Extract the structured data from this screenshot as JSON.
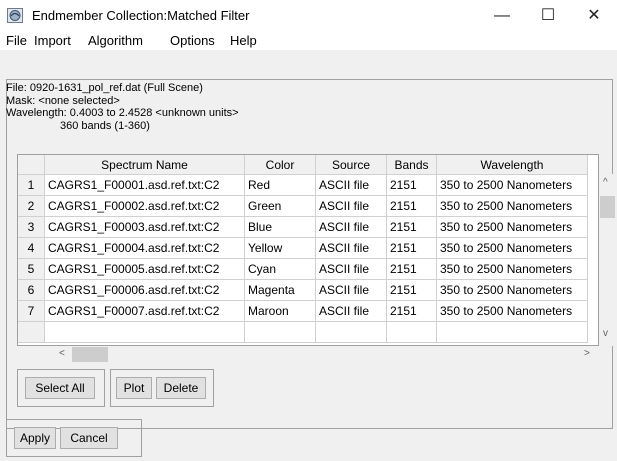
{
  "window": {
    "title": "Endmember Collection:Matched Filter",
    "minimize": "—",
    "maximize": "☐",
    "close": "✕",
    "icon": "envi-app-icon"
  },
  "menubar": [
    "File",
    "Import",
    "Algorithm",
    "Options",
    "Help"
  ],
  "info": {
    "file": "File: 0920-1631_pol_ref.dat (Full Scene)",
    "mask": "Mask: <none selected>",
    "wavelength": "Wavelength: 0.4003 to 2.4528 <unknown units>",
    "bands": "360 bands (1-360)"
  },
  "table": {
    "columns": [
      "Spectrum Name",
      "Color",
      "Source",
      "Bands",
      "Wavelength"
    ],
    "rows": [
      {
        "num": "1",
        "name": "CAGRS1_F00001.asd.ref.txt:C2",
        "color": "Red",
        "source": "ASCII file",
        "bands": "2151",
        "wavelength": "350 to 2500 Nanometers"
      },
      {
        "num": "2",
        "name": "CAGRS1_F00002.asd.ref.txt:C2",
        "color": "Green",
        "source": "ASCII file",
        "bands": "2151",
        "wavelength": "350 to 2500 Nanometers"
      },
      {
        "num": "3",
        "name": "CAGRS1_F00003.asd.ref.txt:C2",
        "color": "Blue",
        "source": "ASCII file",
        "bands": "2151",
        "wavelength": "350 to 2500 Nanometers"
      },
      {
        "num": "4",
        "name": "CAGRS1_F00004.asd.ref.txt:C2",
        "color": "Yellow",
        "source": "ASCII file",
        "bands": "2151",
        "wavelength": "350 to 2500 Nanometers"
      },
      {
        "num": "5",
        "name": "CAGRS1_F00005.asd.ref.txt:C2",
        "color": "Cyan",
        "source": "ASCII file",
        "bands": "2151",
        "wavelength": "350 to 2500 Nanometers"
      },
      {
        "num": "6",
        "name": "CAGRS1_F00006.asd.ref.txt:C2",
        "color": "Magenta",
        "source": "ASCII file",
        "bands": "2151",
        "wavelength": "350 to 2500 Nanometers"
      },
      {
        "num": "7",
        "name": "CAGRS1_F00007.asd.ref.txt:C2",
        "color": "Maroon",
        "source": "ASCII file",
        "bands": "2151",
        "wavelength": "350 to 2500 Nanometers"
      }
    ]
  },
  "buttons": {
    "select_all": "Select All",
    "plot": "Plot",
    "delete": "Delete",
    "apply": "Apply",
    "cancel": "Cancel"
  },
  "scroll_glyphs": {
    "up": "^",
    "down": "v",
    "left": "<",
    "right": ">"
  }
}
